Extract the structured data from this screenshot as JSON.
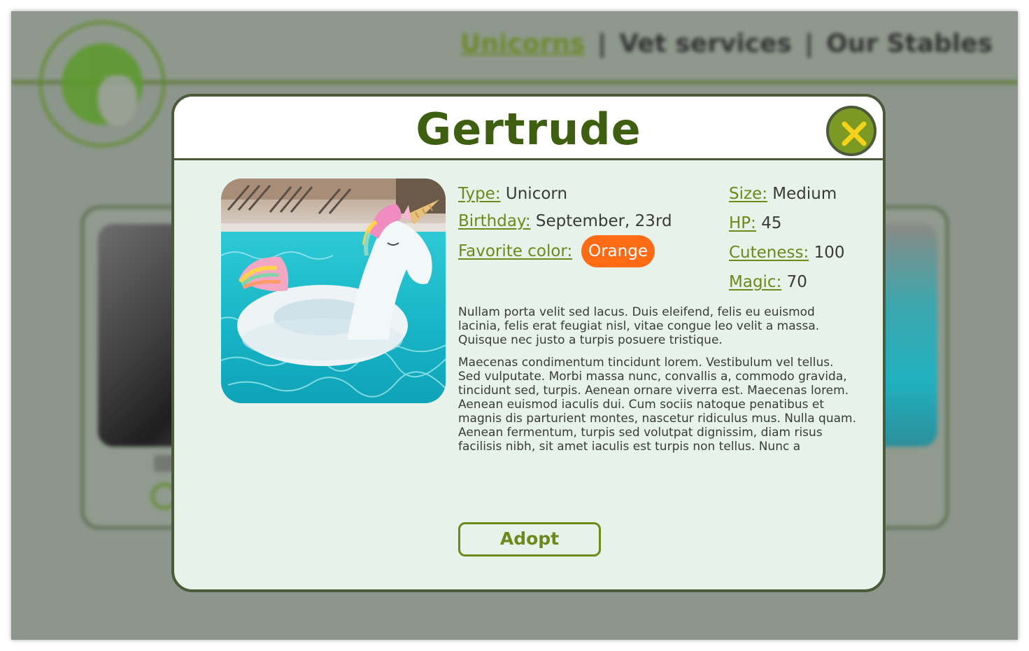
{
  "background": {
    "nav": {
      "items": [
        "Unicorns",
        "Vet services",
        "Our Stables"
      ],
      "separator": "|"
    }
  },
  "modal": {
    "title": "Gertrude",
    "close_icon": "close-x-icon",
    "photo_alt": "Inflatable unicorn pool float in a swimming pool",
    "details": {
      "type_label": "Type:",
      "type_value": "Unicorn",
      "birthday_label": "Birthday:",
      "birthday_value": "September, 23rd",
      "color_label": "Favorite color:",
      "color_value": "Orange",
      "size_label": "Size:",
      "size_value": "Medium",
      "hp_label": "HP:",
      "hp_value": "45",
      "cuteness_label": "Cuteness:",
      "cuteness_value": "100",
      "magic_label": "Magic:",
      "magic_value": "70"
    },
    "description": [
      "Nullam porta velit sed lacus. Duis eleifend, felis eu euismod lacinia, felis erat feugiat nisl, vitae congue leo velit a massa. Quisque nec justo a turpis posuere tristique.",
      "Maecenas condimentum tincidunt lorem. Vestibulum vel tellus. Sed vulputate. Morbi massa nunc, convallis a, commodo gravida, tincidunt sed, turpis. Aenean ornare viverra est. Maecenas lorem. Aenean euismod iaculis dui. Cum sociis natoque penatibus et magnis dis parturient montes, nascetur ridiculus mus. Nulla quam. Aenean fermentum, turpis sed volutpat dignissim, diam risus facilisis nibh, sit amet iaculis est turpis non tellus. Nunc a"
    ],
    "adopt_label": "Adopt"
  },
  "colors": {
    "accent_green": "#6a8a1a",
    "title_green": "#3f5f10",
    "close_button": "#7c9a23",
    "close_x": "#f2d21a",
    "favorite_color_pill": "#ff6a14",
    "modal_background": "#e6f2ea",
    "modal_border": "#4c5a3a"
  }
}
